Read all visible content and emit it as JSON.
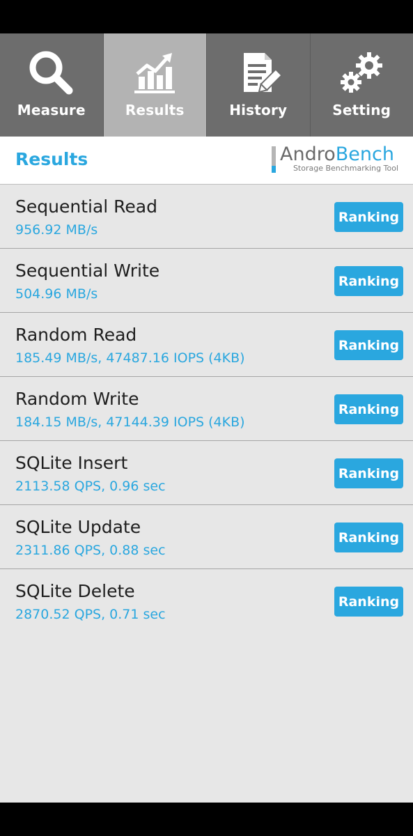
{
  "tabs": [
    {
      "label": "Measure",
      "icon": "magnifier-icon",
      "active": false
    },
    {
      "label": "Results",
      "icon": "chart-icon",
      "active": true
    },
    {
      "label": "History",
      "icon": "document-pencil-icon",
      "active": false
    },
    {
      "label": "Setting",
      "icon": "gears-icon",
      "active": false
    }
  ],
  "header": {
    "title": "Results",
    "logo_andro": "Andro",
    "logo_bench": "Bench",
    "logo_tagline": "Storage Benchmarking Tool"
  },
  "results": [
    {
      "name": "Sequential Read",
      "value": "956.92 MB/s",
      "button": "Ranking"
    },
    {
      "name": "Sequential Write",
      "value": "504.96 MB/s",
      "button": "Ranking"
    },
    {
      "name": "Random Read",
      "value": "185.49 MB/s, 47487.16 IOPS (4KB)",
      "button": "Ranking"
    },
    {
      "name": "Random Write",
      "value": "184.15 MB/s, 47144.39 IOPS (4KB)",
      "button": "Ranking"
    },
    {
      "name": "SQLite Insert",
      "value": "2113.58 QPS, 0.96 sec",
      "button": "Ranking"
    },
    {
      "name": "SQLite Update",
      "value": "2311.86 QPS, 0.88 sec",
      "button": "Ranking"
    },
    {
      "name": "SQLite Delete",
      "value": "2870.52 QPS, 0.71 sec",
      "button": "Ranking"
    }
  ],
  "colors": {
    "accent": "#2aa7df",
    "tab_bg": "#6d6d6d",
    "tab_active_bg": "#b3b3b3",
    "list_bg": "#e7e7e7"
  }
}
